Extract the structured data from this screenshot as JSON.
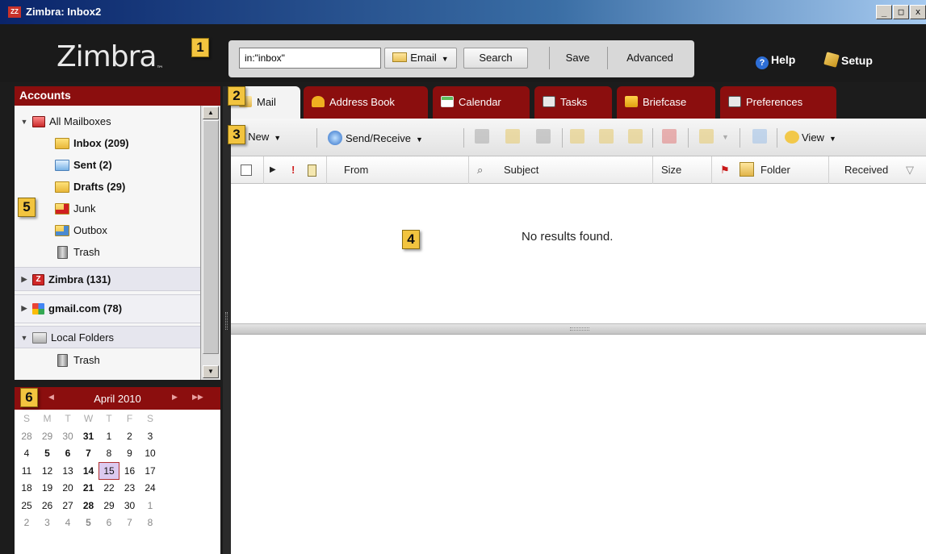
{
  "window": {
    "title": "Zimbra: Inbox2",
    "app_icon": "zimbra-z-icon",
    "controls": [
      "_",
      "□",
      "x"
    ]
  },
  "header": {
    "logo": "Zimbra",
    "logo_prefix": "Z",
    "search": {
      "query": "in:\"inbox\"",
      "type_label": "Email",
      "search_label": "Search",
      "save_label": "Save",
      "advanced_label": "Advanced"
    },
    "help_label": "Help",
    "setup_label": "Setup"
  },
  "callouts": [
    "1",
    "2",
    "3",
    "4",
    "5",
    "6"
  ],
  "accounts": {
    "title": "Accounts",
    "all_mailboxes": "All Mailboxes",
    "folders": [
      {
        "label": "Inbox (209)",
        "bold": true
      },
      {
        "label": "Sent (2)",
        "bold": true
      },
      {
        "label": "Drafts (29)",
        "bold": true
      },
      {
        "label": "Junk",
        "bold": false
      },
      {
        "label": "Outbox",
        "bold": false
      },
      {
        "label": "Trash",
        "bold": false
      }
    ],
    "zimbra": "Zimbra (131)",
    "gmail": "gmail.com (78)",
    "local_folders": "Local Folders",
    "local_trash": "Trash"
  },
  "calendar": {
    "month": "April 2010",
    "days_of_week": [
      "S",
      "M",
      "T",
      "W",
      "T",
      "F",
      "S"
    ],
    "weeks": [
      [
        "28",
        "29",
        "30",
        "31",
        "1",
        "2",
        "3"
      ],
      [
        "4",
        "5",
        "6",
        "7",
        "8",
        "9",
        "10"
      ],
      [
        "11",
        "12",
        "13",
        "14",
        "15",
        "16",
        "17"
      ],
      [
        "18",
        "19",
        "20",
        "21",
        "22",
        "23",
        "24"
      ],
      [
        "25",
        "26",
        "27",
        "28",
        "29",
        "30",
        "1"
      ],
      [
        "2",
        "3",
        "4",
        "5",
        "6",
        "7",
        "8"
      ]
    ],
    "bold_days": [
      "31",
      "5",
      "6",
      "7",
      "14",
      "21",
      "28"
    ],
    "today": "15"
  },
  "tabs": [
    {
      "label": "Mail",
      "icon": "mail-icon",
      "active": true
    },
    {
      "label": "Address Book",
      "icon": "address-book-icon",
      "active": false
    },
    {
      "label": "Calendar",
      "icon": "calendar-icon",
      "active": false
    },
    {
      "label": "Tasks",
      "icon": "tasks-icon",
      "active": false
    },
    {
      "label": "Briefcase",
      "icon": "briefcase-icon",
      "active": false
    },
    {
      "label": "Preferences",
      "icon": "preferences-icon",
      "active": false
    }
  ],
  "toolbar": {
    "new_label": "New",
    "send_receive_label": "Send/Receive",
    "view_label": "View"
  },
  "list": {
    "columns": [
      "From",
      "Subject",
      "Size",
      "Folder",
      "Received"
    ],
    "empty_message": "No results found."
  }
}
